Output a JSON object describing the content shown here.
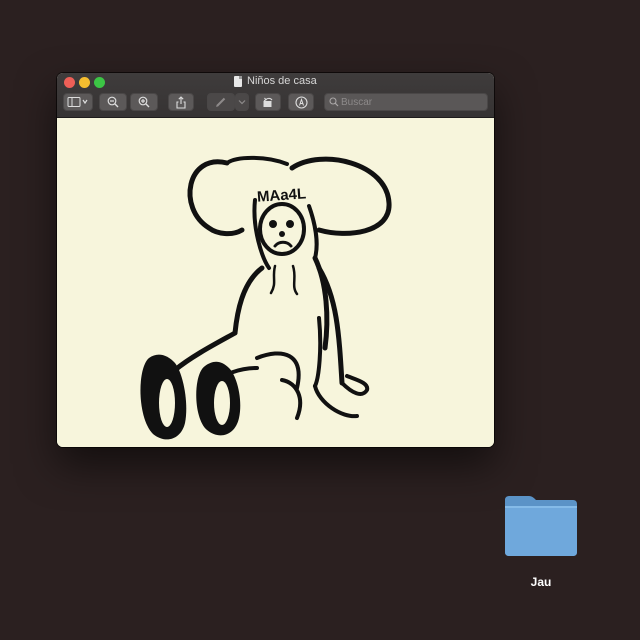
{
  "window": {
    "title": "Niños de casa",
    "search_placeholder": "Buscar"
  },
  "toolbar": {
    "icons": [
      "sidebar-icon",
      "zoom-out-icon",
      "zoom-in-icon",
      "share-icon",
      "markup-pen-icon",
      "rotate-icon",
      "annotate-icon",
      "search-icon"
    ]
  },
  "document": {
    "drawing_text": "MAa4L"
  },
  "desktop": {
    "folder_label": "Jau"
  },
  "colors": {
    "desktop": "#2b2020",
    "paper": "#f7f5dc",
    "folder": "#6fa8dc"
  }
}
